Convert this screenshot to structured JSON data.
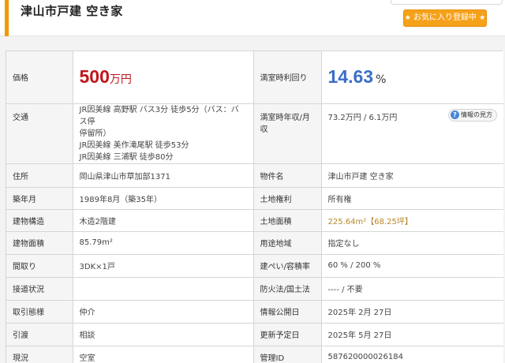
{
  "header": {
    "title": "津山市戸建 空き家",
    "favorite_button": "お気に入り登録中"
  },
  "property": {
    "price_label": "価格",
    "price_value": "500",
    "price_unit": "万円",
    "yield_label": "満室時利回り",
    "yield_value": "14.63",
    "yield_unit": "%",
    "traffic_label": "交通",
    "traffic_lines": [
      "JR因美線 高野駅 バス3分 徒歩5分（バス：バス停",
      "停留所）",
      "JR因美線 美作滝尾駅 徒歩53分",
      "JR因美線 三浦駅 徒歩80分"
    ],
    "income_label": "満室時年収/月収",
    "income_value": "73.2万円 / 6.1万円",
    "help_label": "情報の見方",
    "address_label": "住所",
    "address_value": "岡山県津山市草加部1371",
    "name_label": "物件名",
    "name_value": "津山市戸建 空き家",
    "built_label": "築年月",
    "built_value": "1989年8月（築35年）",
    "land_right_label": "土地権利",
    "land_right_value": "所有権",
    "structure_label": "建物構造",
    "structure_value": "木造2階建",
    "land_area_label": "土地面積",
    "land_area_value": "225.64m²【68.25坪】",
    "building_area_label": "建物面積",
    "building_area_value": "85.79m²",
    "zoning_label": "用途地域",
    "zoning_value": "指定なし",
    "layout_label": "間取り",
    "layout_value": "3DK×1戸",
    "coverage_label": "建ぺい/容積率",
    "coverage_value": "60 % / 200 %",
    "road_label": "接道状況",
    "road_value": "",
    "fire_label": "防火法/国土法",
    "fire_value": "---- / 不要",
    "transaction_label": "取引態様",
    "transaction_value": "仲介",
    "published_label": "情報公開日",
    "published_value": "2025年 2月 27日",
    "handover_label": "引渡",
    "handover_value": "相談",
    "update_label": "更新予定日",
    "update_value": "2025年 5月 27日",
    "status_label": "現況",
    "status_value": "空室",
    "id_label": "管理ID",
    "id_value": "587620000026184"
  },
  "colors": {
    "accent": "#f39800",
    "price": "#c0161b",
    "yield": "#3a6fc7",
    "area_link": "#b8862b"
  }
}
